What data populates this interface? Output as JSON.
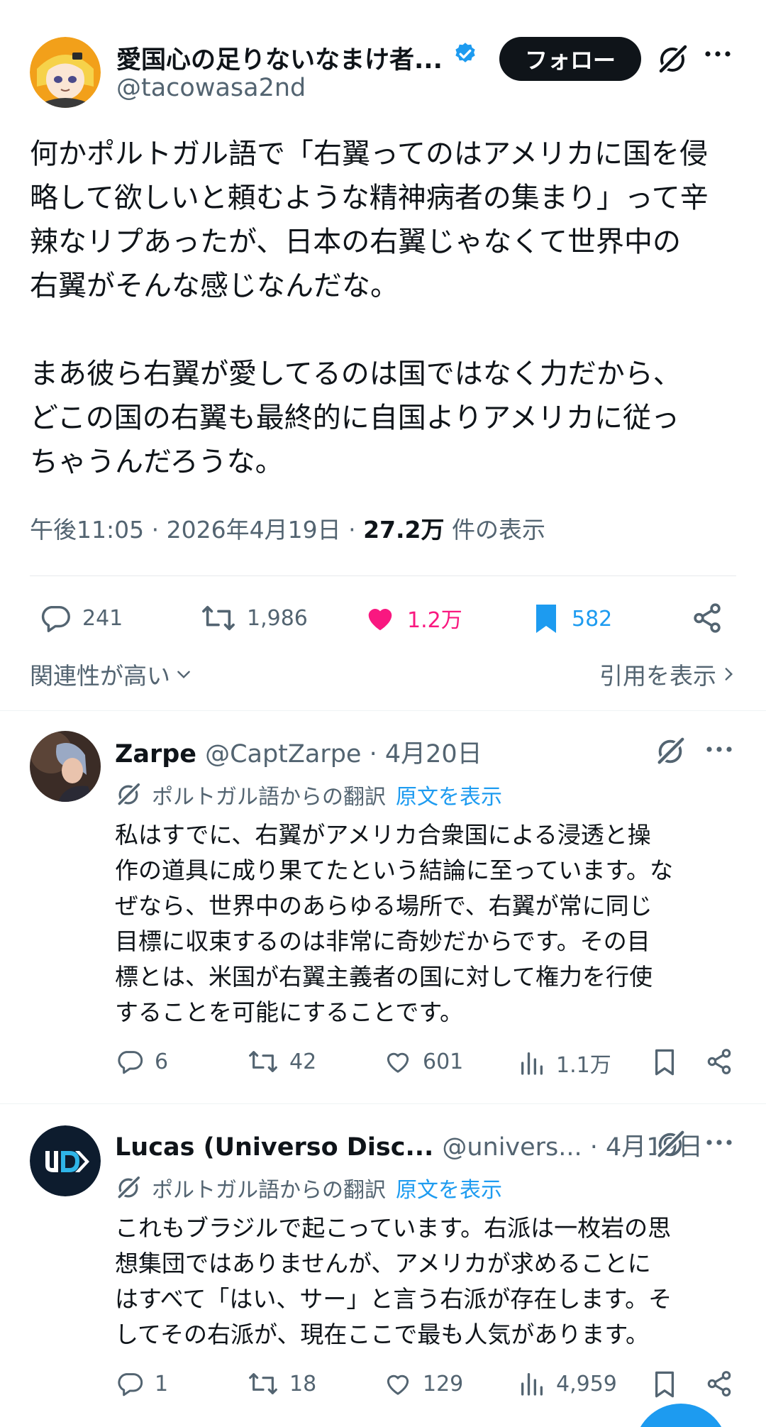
{
  "main_tweet": {
    "author_name": "愛国心の足りないなまけ者...",
    "author_handle": "@tacowasa2nd",
    "follow_label": "フォロー",
    "text": "何かポルトガル語で「右翼ってのはアメリカに国を侵\n略して欲しいと頼むような精神病者の集まり」って辛\n辣なリプあったが、日本の右翼じゃなくて世界中の\n右翼がそんな感じなんだな。\n\nまあ彼ら右翼が愛してるのは国ではなく力だから、\nどこの国の右翼も最終的に自国よりアメリカに従っ\nちゃうんだろうな。",
    "time": "午後11:05",
    "date": "2026年4月19日",
    "views": "27.2万",
    "views_label": "件の表示",
    "separator": "·",
    "replies": "241",
    "reposts": "1,986",
    "likes": "1.2万",
    "bookmarks": "582"
  },
  "sort": {
    "label": "関連性が高い",
    "quotes_label": "引用を表示"
  },
  "replies": [
    {
      "name": "Zarpe",
      "handle": "@CaptZarpe · 4月20日",
      "translation_label": "ポルトガル語からの翻訳",
      "show_original": "原文を表示",
      "text": "私はすでに、右翼がアメリカ合衆国による浸透と操\n作の道具に成り果てたという結論に至っています。な\nぜなら、世界中のあらゆる場所で、右翼が常に同じ\n目標に収束するのは非常に奇妙だからです。その目\n標とは、米国が右翼主義者の国に対して権力を行使\nすることを可能にすることです。",
      "replies": "6",
      "reposts": "42",
      "likes": "601",
      "views": "1.1万"
    },
    {
      "name": "Lucas (Universo Disc...",
      "handle": "@univers... · 4月19日",
      "translation_label": "ポルトガル語からの翻訳",
      "show_original": "原文を表示",
      "text": "これもブラジルで起こっています。右派は一枚岩の思\n想集団ではありませんが、アメリカが求めることに\nはすべて「はい、サー」と言う右派が存在します。そ\nしてその右派が、現在ここで最も人気があります。",
      "replies": "1",
      "reposts": "18",
      "likes": "129",
      "views": "4,959"
    }
  ],
  "colors": {
    "accent": "#1d9bf0",
    "like": "#f91880",
    "text": "#0f1419",
    "muted": "#536471"
  }
}
